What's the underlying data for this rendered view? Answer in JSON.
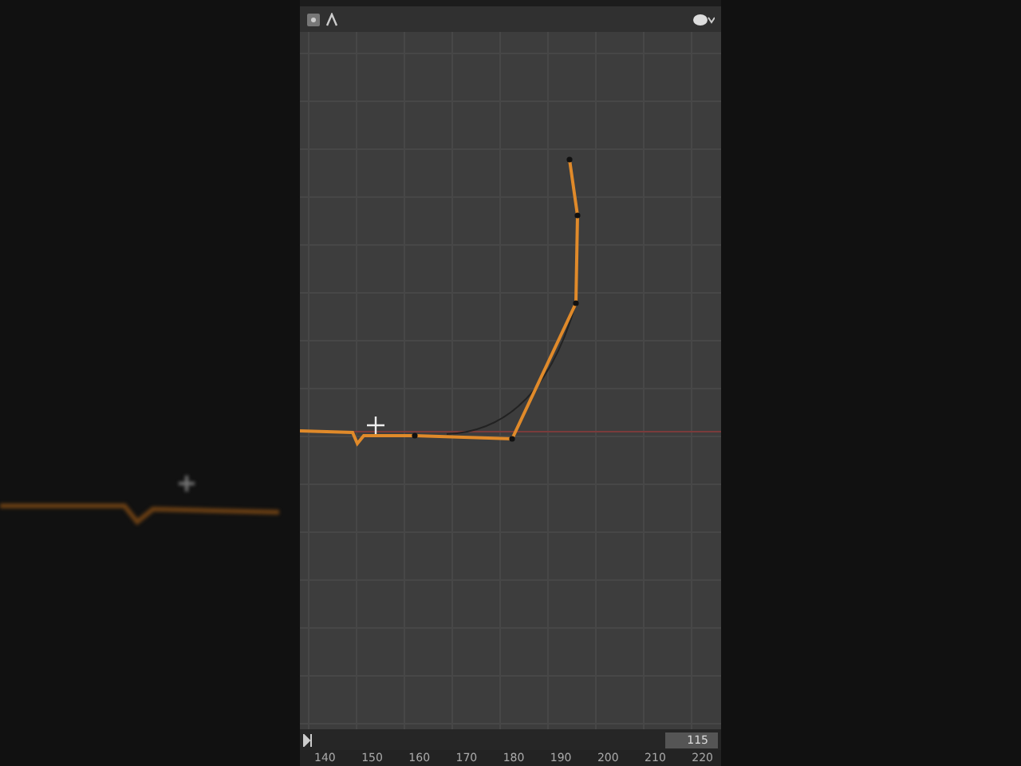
{
  "timeline": {
    "current_frame": "115"
  },
  "axis": {
    "ticks": [
      "140",
      "150",
      "160",
      "170",
      "180",
      "190",
      "200",
      "210",
      "220"
    ]
  }
}
